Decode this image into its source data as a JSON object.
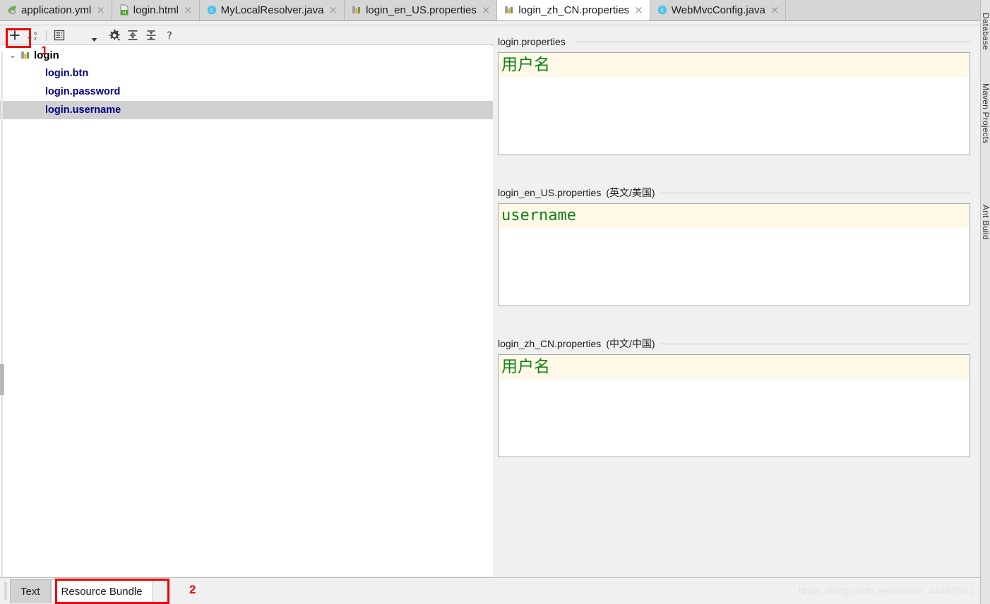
{
  "window": {
    "watermark": "https://blog.csdn.net/weixin_44467251"
  },
  "editor_tabs": [
    {
      "label": "application.yml",
      "icon": "spring-yaml-icon",
      "close": "×",
      "active": false
    },
    {
      "label": "login.html",
      "icon": "html-file-icon",
      "close": "×",
      "active": false
    },
    {
      "label": "MyLocalResolver.java",
      "icon": "java-class-icon",
      "close": "×",
      "active": false
    },
    {
      "label": "login_en_US.properties",
      "icon": "properties-icon",
      "close": "×",
      "active": false
    },
    {
      "label": "login_zh_CN.properties",
      "icon": "properties-icon",
      "close": "×",
      "active": true
    },
    {
      "label": "WebMvcConfig.java",
      "icon": "java-class-icon",
      "close": "×",
      "active": false
    }
  ],
  "toolbar": {
    "buttons": [
      {
        "name": "add-property-button",
        "icon": "plus-icon",
        "tooltip": "Add Property"
      },
      {
        "name": "sort-alphabetically-button",
        "icon": "sort-az-icon",
        "tooltip": "Sort"
      },
      {
        "name": "group-by-prefix-button",
        "icon": "properties-list-icon",
        "tooltip": "Group"
      },
      {
        "name": "more-options-button",
        "icon": "chevron-down-icon",
        "tooltip": "More"
      },
      {
        "name": "settings-button",
        "icon": "gear-icon",
        "tooltip": "Settings"
      },
      {
        "name": "expand-all-button",
        "icon": "expand-all-icon",
        "tooltip": "Expand All"
      },
      {
        "name": "collapse-all-button",
        "icon": "collapse-all-icon",
        "tooltip": "Collapse All"
      },
      {
        "name": "help-button",
        "icon": "question-mark-icon",
        "tooltip": "Help"
      }
    ]
  },
  "tree": {
    "root": {
      "label": "login",
      "icon": "properties-bundle-icon",
      "expanded": true,
      "twisty": "⌄"
    },
    "items": [
      {
        "label": "login.btn",
        "selected": false
      },
      {
        "label": "login.password",
        "selected": false
      },
      {
        "label": "login.username",
        "selected": true
      }
    ]
  },
  "sections": [
    {
      "label": "login.properties",
      "locale": "",
      "value": "用户名",
      "cjk": true
    },
    {
      "label": "login_en_US.properties",
      "locale": "(英文/美国)",
      "value": "username",
      "cjk": false
    },
    {
      "label": "login_zh_CN.properties",
      "locale": "(中文/中国)",
      "value": "用户名",
      "cjk": true
    }
  ],
  "bottom_tabs": [
    {
      "label": "Text",
      "active": false
    },
    {
      "label": "Resource Bundle",
      "active": true
    }
  ],
  "annotations": [
    {
      "number": "1"
    },
    {
      "number": "2"
    }
  ],
  "right_rail": [
    {
      "label": "Database"
    },
    {
      "label": "Maven Projects"
    },
    {
      "label": "Ant Build"
    }
  ],
  "colors": {
    "accent_red": "#ee0000",
    "value_green": "#12801a",
    "key_navy": "#000080",
    "highlight_cream": "#fdf9e6",
    "selection_gray": "#d0d0d0"
  }
}
